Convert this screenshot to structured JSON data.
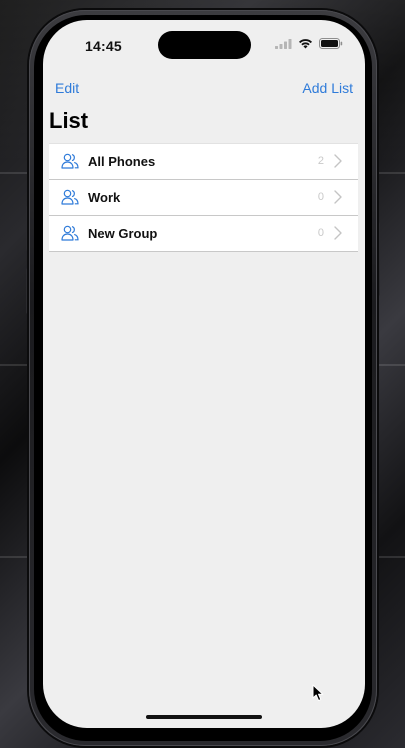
{
  "status_bar": {
    "time": "14:45",
    "icons": [
      "cellular-signal-icon",
      "wifi-icon",
      "battery-icon"
    ]
  },
  "nav": {
    "edit_label": "Edit",
    "add_label": "Add List"
  },
  "page": {
    "title": "List"
  },
  "list": {
    "items": [
      {
        "label": "All Phones",
        "count": "2",
        "icon": "people-icon"
      },
      {
        "label": "Work",
        "count": "0",
        "icon": "people-icon"
      },
      {
        "label": "New Group",
        "count": "0",
        "icon": "people-icon"
      }
    ]
  },
  "colors": {
    "accent": "#2f7bd9",
    "background": "#efefef",
    "row_background": "#ffffff",
    "count_text": "#c9c9c9"
  }
}
